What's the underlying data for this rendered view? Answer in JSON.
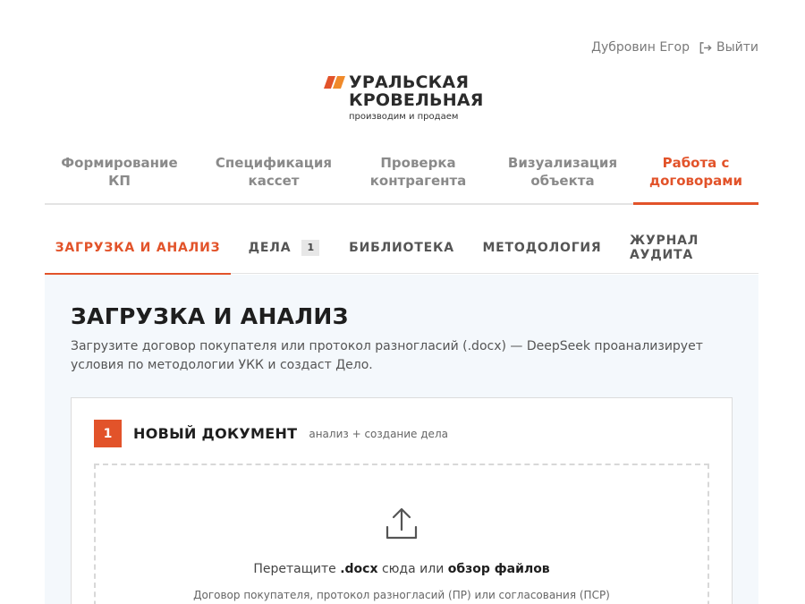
{
  "user": {
    "name": "Дубровин Егор",
    "logout_label": "Выйти"
  },
  "logo": {
    "line1": "УРАЛЬСКАЯ",
    "line2": "КРОВЕЛЬНАЯ",
    "tagline": "производим и продаем",
    "colors": [
      "#e2532a",
      "#f08a2a"
    ]
  },
  "topnav": {
    "items": [
      {
        "label": "Формирование КП",
        "active": false
      },
      {
        "label": "Спецификация кассет",
        "active": false
      },
      {
        "label": "Проверка контрагента",
        "active": false
      },
      {
        "label": "Визуализация объекта",
        "active": false
      },
      {
        "label": "Работа с договорами",
        "active": true
      }
    ]
  },
  "subtabs": {
    "items": [
      {
        "label": "ЗАГРУЗКА И АНАЛИЗ",
        "active": true
      },
      {
        "label": "ДЕЛА",
        "badge": "1",
        "active": false
      },
      {
        "label": "БИБЛИОТЕКА",
        "active": false
      },
      {
        "label": "МЕТОДОЛОГИЯ",
        "active": false
      },
      {
        "label": "ЖУРНАЛ АУДИТА",
        "active": false
      }
    ]
  },
  "main": {
    "title": "ЗАГРУЗКА И АНАЛИЗ",
    "description": "Загрузите договор покупателя или протокол разногласий (.docx) — DeepSeek проанализирует условия по методологии УКК и создаст Дело.",
    "card": {
      "step": "1",
      "title": "НОВЫЙ ДОКУМЕНТ",
      "subtitle": "анализ + создание дела",
      "dropzone": {
        "icon": "upload-icon",
        "text_before": "Перетащите",
        "extension": ".docx",
        "text_middle": "сюда или",
        "browse_label": "обзор файлов",
        "hint": "Договор покупателя, протокол разногласий (ПР) или согласования (ПСР)"
      }
    }
  },
  "colors": {
    "accent": "#e2532a",
    "content_bg": "#f4f8fc",
    "muted": "#8a8a8a"
  }
}
